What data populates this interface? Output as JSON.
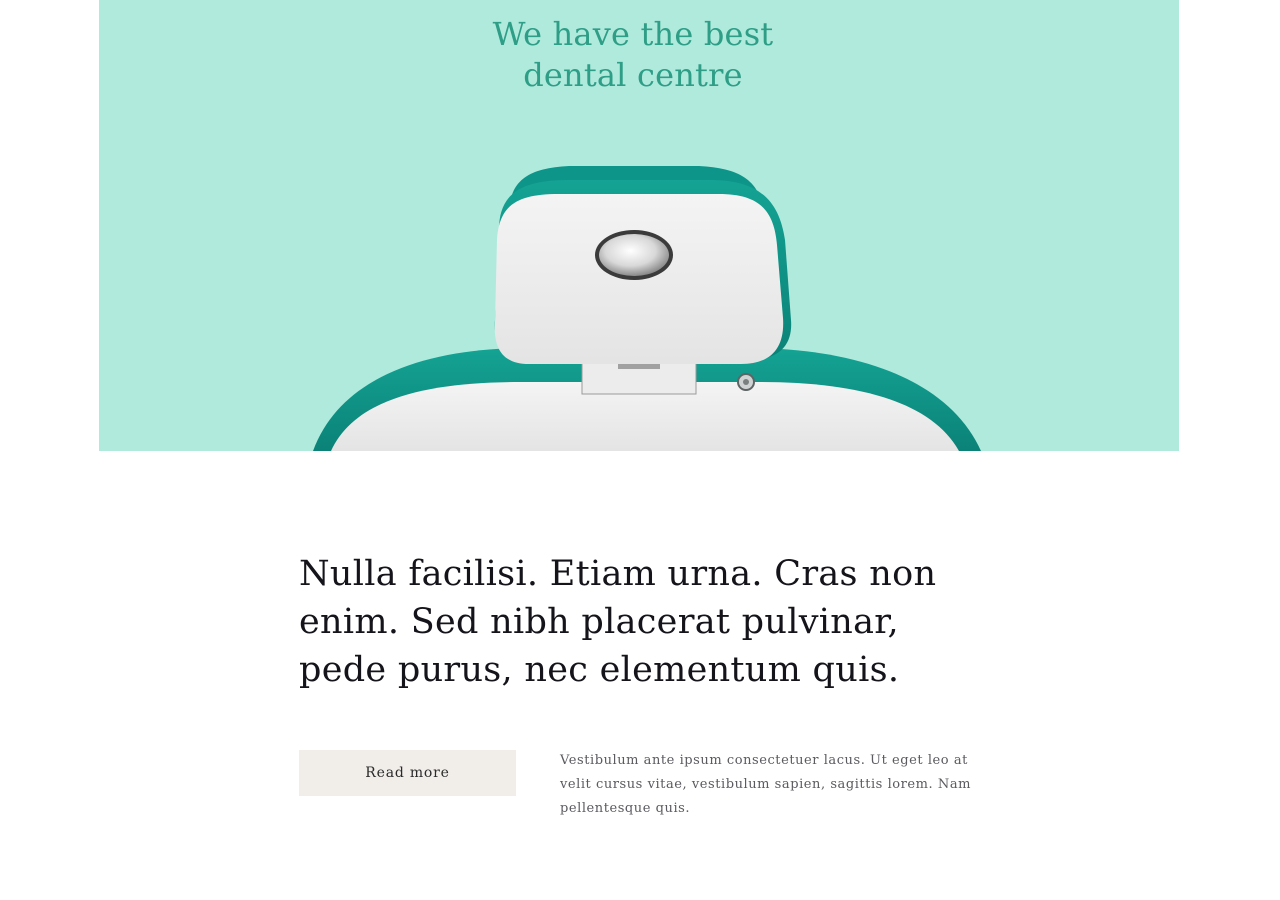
{
  "hero": {
    "title_line1": "We have the best",
    "title_line2": "dental centre",
    "background_color": "#b0eadd",
    "title_color": "#2e9e86",
    "image": "dental-chair-headrest-image"
  },
  "content": {
    "headline": "Nulla facilisi. Etiam urna. Cras non enim. Sed nibh placerat pulvinar, pede purus, nec elementum quis.",
    "button_label": "Read more",
    "button_color": "#f1eeea",
    "body": "Vestibulum ante ipsum consectetuer lacus. Ut eget leo at velit cursus vitae, vestibulum sapien, sagittis lorem. Nam pellentesque quis."
  }
}
